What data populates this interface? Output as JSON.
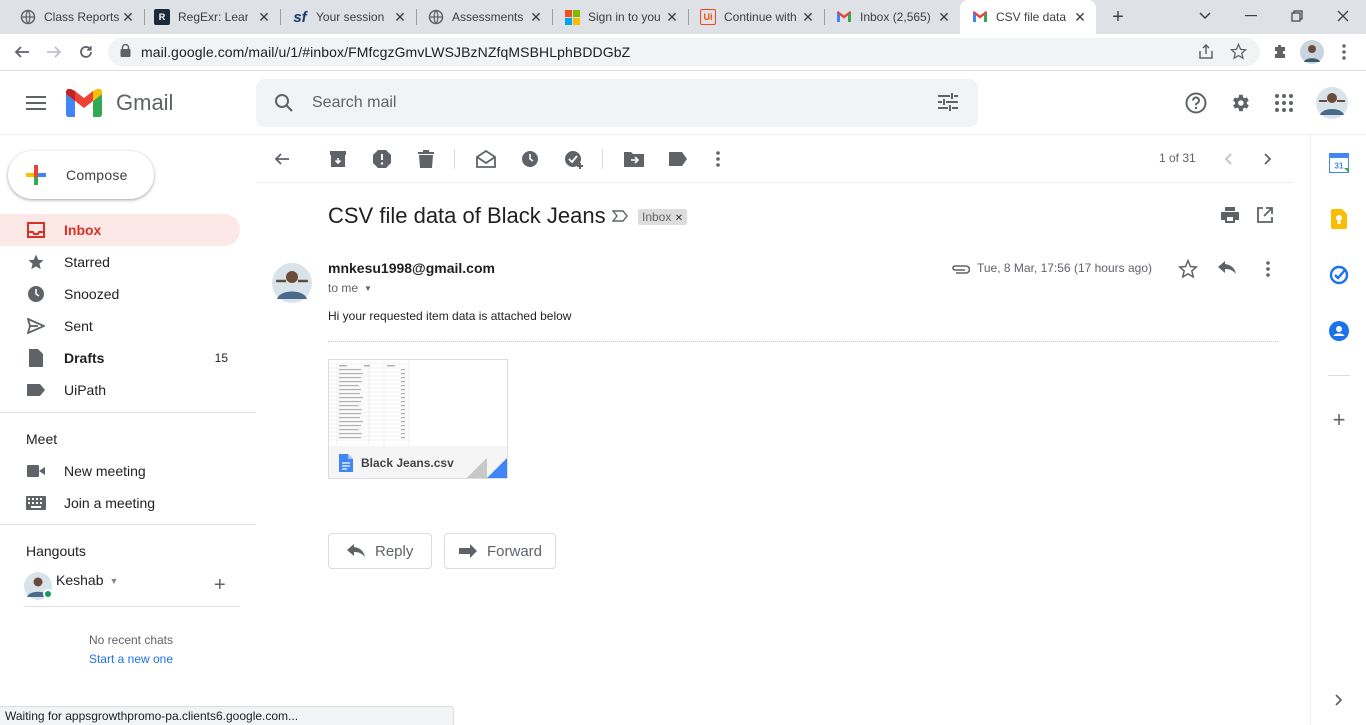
{
  "browser": {
    "tabs": [
      {
        "title": "Class Reports",
        "favicon": "globe-icon"
      },
      {
        "title": "RegExr: Learn",
        "favicon": "regexr-icon"
      },
      {
        "title": "Your session I",
        "favicon": "sf-icon"
      },
      {
        "title": "Assessments",
        "favicon": "globe-icon"
      },
      {
        "title": "Sign in to you",
        "favicon": "microsoft-icon"
      },
      {
        "title": "Continue with",
        "favicon": "uipath-icon"
      },
      {
        "title": "Inbox (2,565)",
        "favicon": "gmail-icon"
      },
      {
        "title": "CSV file data",
        "favicon": "gmail-icon"
      }
    ],
    "url": "mail.google.com/mail/u/1/#inbox/FMfcgzGmvLWSJBzNZfqMSBHLphBDDGbZ",
    "status": "Waiting for appsgrowthpromo-pa.clients6.google.com..."
  },
  "gmail": {
    "logo": "Gmail",
    "search_placeholder": "Search mail",
    "compose": "Compose",
    "nav": [
      {
        "label": "Inbox",
        "count": ""
      },
      {
        "label": "Starred",
        "count": ""
      },
      {
        "label": "Snoozed",
        "count": ""
      },
      {
        "label": "Sent",
        "count": ""
      },
      {
        "label": "Drafts",
        "count": "15"
      },
      {
        "label": "UiPath",
        "count": ""
      }
    ],
    "meet": {
      "title": "Meet",
      "new_meeting": "New meeting",
      "join_meeting": "Join a meeting"
    },
    "hangouts": {
      "title": "Hangouts",
      "user": "Keshab",
      "no_chats": "No recent chats",
      "start_new": "Start a new one"
    },
    "pagination": "1 of 31"
  },
  "email": {
    "subject": "CSV file data of Black Jeans",
    "label": "Inbox",
    "sender": "mnkesu1998@gmail.com",
    "to": "to me",
    "date": "Tue, 8 Mar, 17:56 (17 hours ago)",
    "body": "Hi your requested item data is attached below",
    "attachment": "Black Jeans.csv",
    "reply": "Reply",
    "forward": "Forward"
  },
  "colors": {
    "gmail_red": "#d93025",
    "inbox_highlight": "#fce8e6",
    "link_blue": "#1a73e8"
  }
}
